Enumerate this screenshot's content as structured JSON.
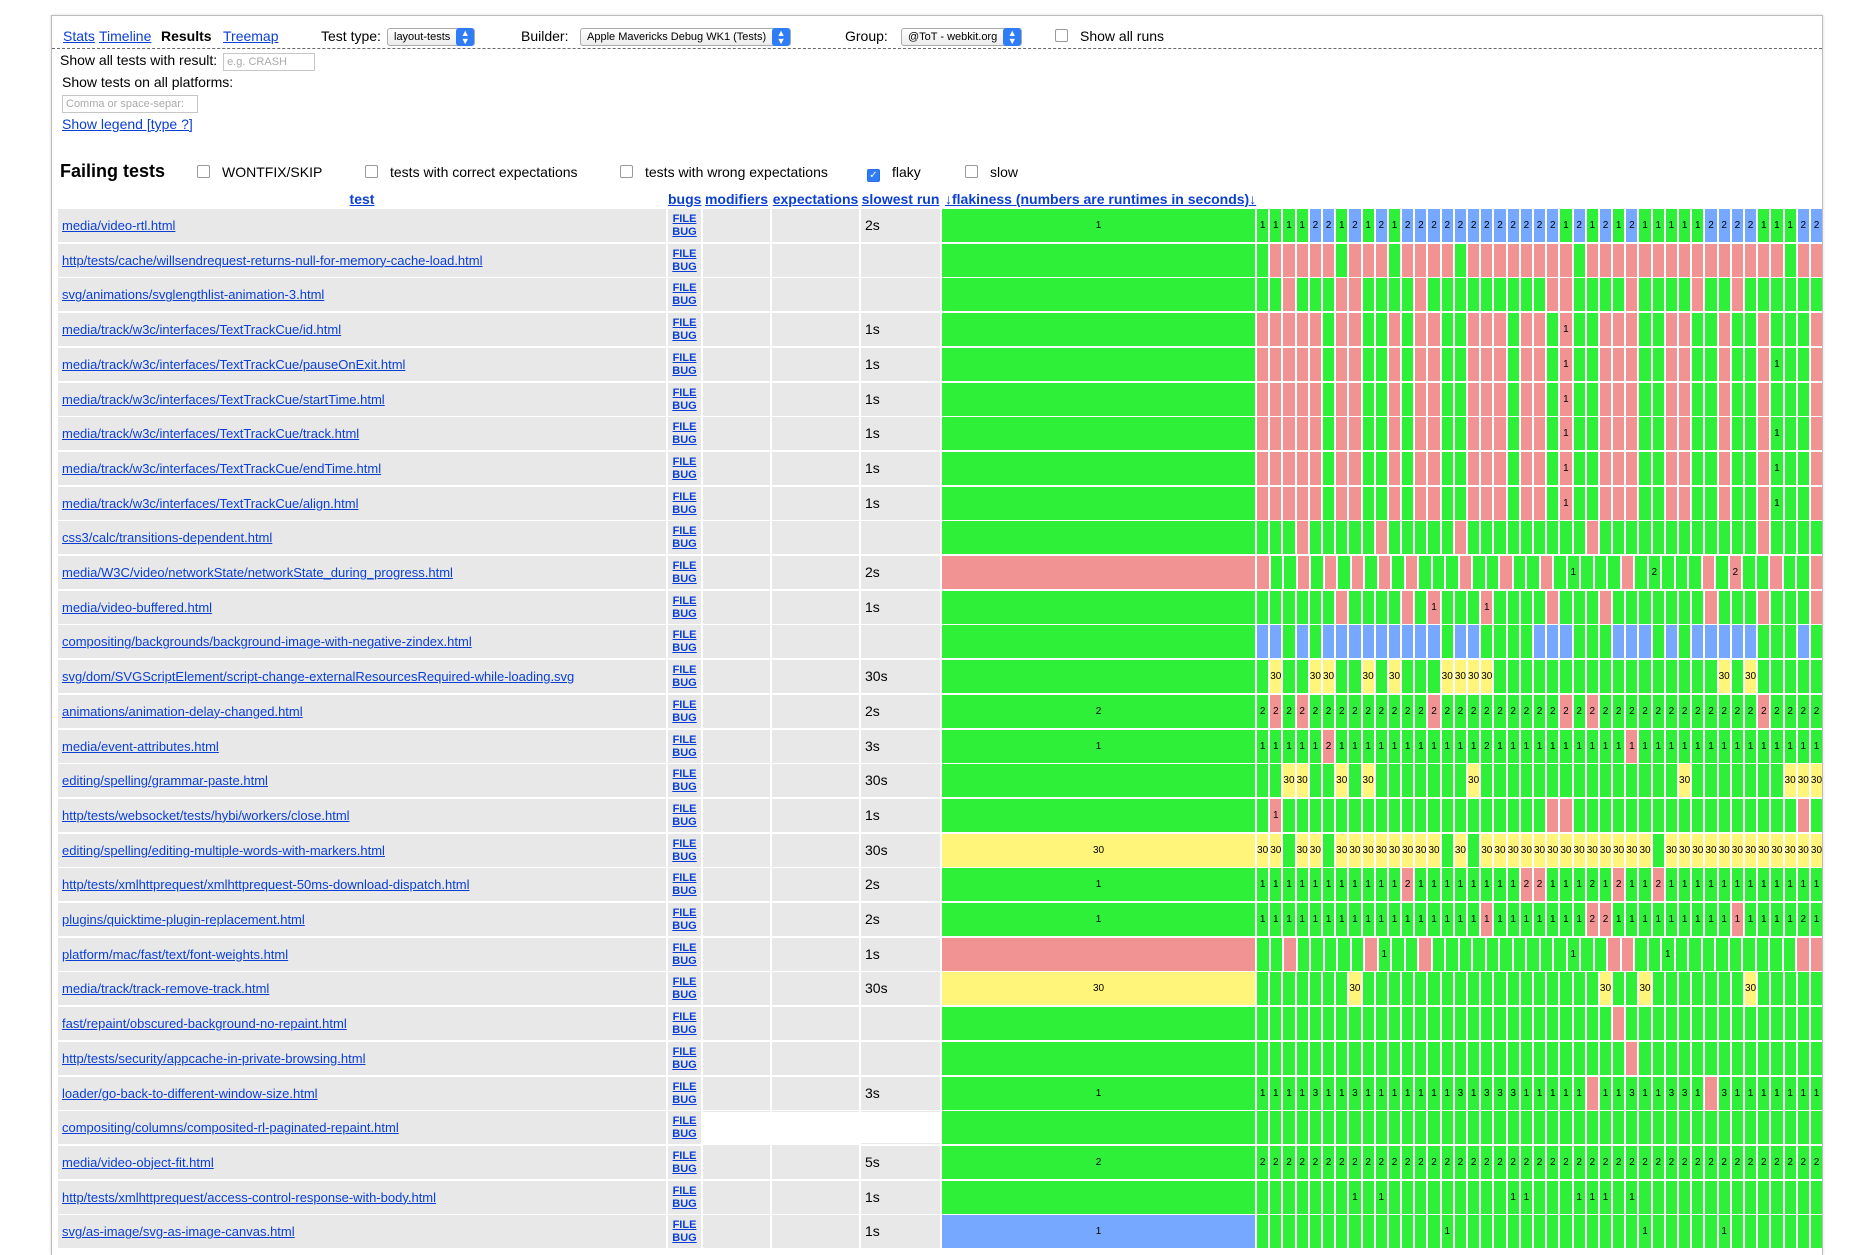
{
  "nav": {
    "stats": "Stats",
    "timeline": "Timeline",
    "results": "Results",
    "treemap": "Treemap",
    "test_type_label": "Test type:",
    "test_type_value": "layout-tests",
    "builder_label": "Builder:",
    "builder_value": "Apple Mavericks Debug WK1 (Tests)",
    "group_label": "Group:",
    "group_value": "@ToT - webkit.org",
    "show_all_runs": "Show all runs"
  },
  "filters": {
    "result_label": "Show all tests with result:",
    "result_placeholder": "e.g. CRASH",
    "platforms_label": "Show tests on all platforms:",
    "platforms_placeholder": "Comma or space-separ:",
    "legend_link": "Show legend [type ?]"
  },
  "failing": {
    "title": "Failing tests",
    "options": [
      {
        "label": "WONTFIX/SKIP",
        "checked": false
      },
      {
        "label": "tests with correct expectations",
        "checked": false
      },
      {
        "label": "tests with wrong expectations",
        "checked": false
      },
      {
        "label": "flaky",
        "checked": true
      },
      {
        "label": "slow",
        "checked": false
      }
    ]
  },
  "columns": {
    "test": "test",
    "bugs": "bugs",
    "modifiers": "modifiers",
    "expectations": "expectations",
    "slowest_run": "slowest run",
    "flakiness": "↓flakiness (numbers are runtimes in seconds)↓"
  },
  "bug_links": {
    "file": "FILE",
    "bug": "BUG"
  },
  "colors": {
    "pass": "#2ef039",
    "fail": "#f29393",
    "timeout": "#fff57a",
    "missing": "#77a8ff"
  },
  "tests": [
    {
      "name": "media/video-rtl.html",
      "slowest": "2s",
      "summary": {
        "color": "g",
        "text": "1"
      },
      "runs": "g1 g1 g1 g1 b2 b2 g1 b2 g1 b2 g1 b2 b2 b2 b2 b2 b2 b2 b2 b2 b2 b2 b2 g1 b2 g1 b2 g1 b2 g1 g1 g1 g1 g1 b2 b2 b2 b2 g1 g1 g1 b2 b2"
    },
    {
      "name": "http/tests/cache/willsendrequest-returns-null-for-memory-cache-load.html",
      "slowest": "",
      "summary": {
        "color": "g",
        "text": ""
      },
      "runs": "g r r r r r g r r r g r r r r g r r r r r r r r g r r r r r r r r r r r r r r r g r r"
    },
    {
      "name": "svg/animations/svglengthlist-animation-3.html",
      "slowest": "",
      "summary": {
        "color": "g",
        "text": ""
      },
      "runs": "g g r g g g r r g g g g r g g g g g g g g g r r g g g g r g g g g r g g r g g g g g g"
    },
    {
      "name": "media/track/w3c/interfaces/TextTrackCue/id.html",
      "slowest": "1s",
      "summary": {
        "color": "g",
        "text": ""
      },
      "runs": "r r r r r g r r g g r g r r g g r r r g r r g r1 g g r r r g g r r g g r g g r g g g r"
    },
    {
      "name": "media/track/w3c/interfaces/TextTrackCue/pauseOnExit.html",
      "slowest": "1s",
      "summary": {
        "color": "g",
        "text": ""
      },
      "runs": "r r r r r g r r g g r g r r g g r r r g r r g r1 g g r r r g g r r g g r g g r g1 g g r"
    },
    {
      "name": "media/track/w3c/interfaces/TextTrackCue/startTime.html",
      "slowest": "1s",
      "summary": {
        "color": "g",
        "text": ""
      },
      "runs": "r r r r r g r r g g r g r r g g r r r g r r g r1 g g r r r g g r r g g r g g r g g g r"
    },
    {
      "name": "media/track/w3c/interfaces/TextTrackCue/track.html",
      "slowest": "1s",
      "summary": {
        "color": "g",
        "text": ""
      },
      "runs": "r r r r r g r r g g r g r r g g r r r g r r g r1 g g r r r g g r r g g r g g r g1 g g r"
    },
    {
      "name": "media/track/w3c/interfaces/TextTrackCue/endTime.html",
      "slowest": "1s",
      "summary": {
        "color": "g",
        "text": ""
      },
      "runs": "r r r r r g r r g g r g r r g g r r r g r r g r1 g g r r r g g r r g g r g g r g1 g g r"
    },
    {
      "name": "media/track/w3c/interfaces/TextTrackCue/align.html",
      "slowest": "1s",
      "summary": {
        "color": "g",
        "text": ""
      },
      "runs": "r r r r r g r r g g r g r r g g r r r g r r g r1 g g r r r g g r r g g r g g r g1 g g r"
    },
    {
      "name": "css3/calc/transitions-dependent.html",
      "slowest": "",
      "summary": {
        "color": "g",
        "text": ""
      },
      "runs": "g g g r g g g g g r g g g g g r g g g g g g g g g r g g g g g g g g g g g g r g g g g"
    },
    {
      "name": "media/W3C/video/networkState/networkState_during_progress.html",
      "slowest": "2s",
      "summary": {
        "color": "r",
        "text": ""
      },
      "runs": "r g g r g r g r g r g r g g g r g g r g g r g g1 g g g r g g2 g g g r g r2 g g r g g r"
    },
    {
      "name": "media/video-buffered.html",
      "slowest": "1s",
      "summary": {
        "color": "g",
        "text": ""
      },
      "runs": "g g g g g g r g g g g r g r1 g g g r1 g g g g r g g g r g g g g g g g r g g g r g g g r"
    },
    {
      "name": "compositing/backgrounds/background-image-with-negative-zindex.html",
      "slowest": "",
      "summary": {
        "color": "g",
        "text": ""
      },
      "runs": "b b g b g b b b b b b b b b g b b g g g g b b b g g g b b b g b g b b b b b g g g b g"
    },
    {
      "name": "svg/dom/SVGScriptElement/script-change-externalResourcesRequired-while-loading.svg",
      "slowest": "30s",
      "summary": {
        "color": "g",
        "text": ""
      },
      "runs": "g y30 g g y30 y30 g g y30 g y30 g g g y30 y30 y30 y30 g g g g g g g g g g g g g g g g g y30 g y30 g g g g g"
    },
    {
      "name": "animations/animation-delay-changed.html",
      "slowest": "2s",
      "summary": {
        "color": "g",
        "text": "2"
      },
      "runs": "g2 r2 g2 r2 g2 g2 g2 g2 g2 g2 g2 g2 g2 r2 g2 g2 g2 g2 g2 g2 g2 g2 g2 r2 g2 r2 g2 g2 g2 g2 g2 g2 g2 g2 g2 g2 g2 g2 r2 g2 g2 g2 g2"
    },
    {
      "name": "media/event-attributes.html",
      "slowest": "3s",
      "summary": {
        "color": "g",
        "text": "1"
      },
      "runs": "g1 g1 g1 g1 g1 r2 g1 g1 g1 g1 g1 g1 g1 g1 g1 g1 g1 g2 g1 g1 g1 g1 g1 g1 g1 g1 g1 g1 r1 g1 g1 g1 g1 g1 g1 g1 g1 g1 g1 g1 g1 g1 g1"
    },
    {
      "name": "editing/spelling/grammar-paste.html",
      "slowest": "30s",
      "summary": {
        "color": "g",
        "text": ""
      },
      "runs": "g g y30 y30 g g y30 g y30 g g g g g g g y30 g g g g g g g g g g g g g g g y30 g g g g g g g y30 y30 y30"
    },
    {
      "name": "http/tests/websocket/tests/hybi/workers/close.html",
      "slowest": "1s",
      "summary": {
        "color": "g",
        "text": ""
      },
      "runs": "g r1 g g g g g g g g g g g g g g g g g g g g r r g g g g g g g g g g g g g g g g g r g"
    },
    {
      "name": "editing/spelling/editing-multiple-words-with-markers.html",
      "slowest": "30s",
      "summary": {
        "color": "y",
        "text": "30"
      },
      "runs": "y30 y30 g y30 y30 g y30 y30 y30 y30 y30 y30 y30 y30 g y30 g y30 y30 y30 y30 y30 y30 y30 y30 y30 y30 y30 y30 y30 g y30 y30 y30 y30 y30 y30 y30 y30 y30 y30 y30 y30"
    },
    {
      "name": "http/tests/xmlhttprequest/xmlhttprequest-50ms-download-dispatch.html",
      "slowest": "2s",
      "summary": {
        "color": "g",
        "text": "1"
      },
      "runs": "g1 g1 g1 g1 g1 g1 g1 g1 g1 g1 g1 r2 g1 g1 g1 g1 g1 g1 g1 g1 r2 r2 g1 g1 g1 g2 g1 r2 g1 g1 r2 g1 g1 g1 g1 g1 g1 g1 g1 g1 g1 g1 g1"
    },
    {
      "name": "plugins/quicktime-plugin-replacement.html",
      "slowest": "2s",
      "summary": {
        "color": "g",
        "text": "1"
      },
      "runs": "g1 g1 g1 g1 g1 g1 g1 g1 g1 g1 g1 g1 g1 g1 g1 g1 g1 r1 g1 g1 g1 g1 g1 g1 g1 r2 r2 g1 g1 g1 g1 g1 g1 g1 g1 g1 r1 g1 g1 g1 g1 g2 g1"
    },
    {
      "name": "platform/mac/fast/text/font-weights.html",
      "slowest": "1s",
      "summary": {
        "color": "r",
        "text": ""
      },
      "runs": "g g r g g g g g r g1 g g r g g g g g g g g g g g1 g g r r g g g1 g g g g g g g g g r r"
    },
    {
      "name": "media/track/track-remove-track.html",
      "slowest": "30s",
      "summary": {
        "color": "y",
        "text": "30"
      },
      "runs": "g g g g g g g y30 g g g g g g g g g g g g g g g g g g y30 g g y30 g g g g g g g y30 g g g g g"
    },
    {
      "name": "fast/repaint/obscured-background-no-repaint.html",
      "slowest": "",
      "summary": {
        "color": "g",
        "text": ""
      },
      "runs": "g g g g g g g g g g g g g g g g g g g g g g g g g g g r g g g g g g g g g g g g g g g"
    },
    {
      "name": "http/tests/security/appcache-in-private-browsing.html",
      "slowest": "",
      "summary": {
        "color": "g",
        "text": ""
      },
      "runs": "g g g g g g g g g g g g g g g g g g g g g g g g g g g g r g g g g g g g g g g g g g g"
    },
    {
      "name": "loader/go-back-to-different-window-size.html",
      "slowest": "3s",
      "summary": {
        "color": "g",
        "text": "1"
      },
      "runs": "g1 g1 g1 g1 g3 g1 g1 g3 g1 g1 g1 g1 g1 g1 g1 g3 g1 g3 g3 g3 g1 g1 g1 g1 g1 r g1 g1 g3 g1 g1 g3 g3 g1 r g3 g1 g1 g1 g1 g1 g1 g1"
    },
    {
      "name": "compositing/columns/composited-rl-paginated-repaint.html",
      "slowest": "",
      "summary": {
        "color": "g",
        "text": ""
      },
      "blank_meta": true,
      "runs": "g g g g g g g g g g g g g g g g g g g g g g g g g g g g g g g g g g g g g g g g g g g"
    },
    {
      "name": "media/video-object-fit.html",
      "slowest": "5s",
      "summary": {
        "color": "g",
        "text": "2"
      },
      "runs": "g2 g2 g2 g2 g2 g2 g2 g2 g2 g2 g2 g2 g2 g2 g2 g2 g2 g2 g2 g2 g2 g2 g2 g2 g2 g2 g2 g2 g2 g2 g2 g2 g2 g2 g2 g2 g2 g2 g2 g2 g2 g2 g2"
    },
    {
      "name": "http/tests/xmlhttprequest/access-control-response-with-body.html",
      "slowest": "1s",
      "summary": {
        "color": "g",
        "text": ""
      },
      "runs": "g g g g g g g g1 g g1 g g g g g g g g g g1 g1 g g g g1 g1 g1 g g1 g g g g g g g g g g g g g g"
    },
    {
      "name": "svg/as-image/svg-as-image-canvas.html",
      "slowest": "1s",
      "summary": {
        "color": "b",
        "text": "1"
      },
      "runs": "g g g g g g g g g g g g g g g1 g g g g g g g g g g g g g g g1 g g g g g g1 g g g g g g g"
    }
  ]
}
